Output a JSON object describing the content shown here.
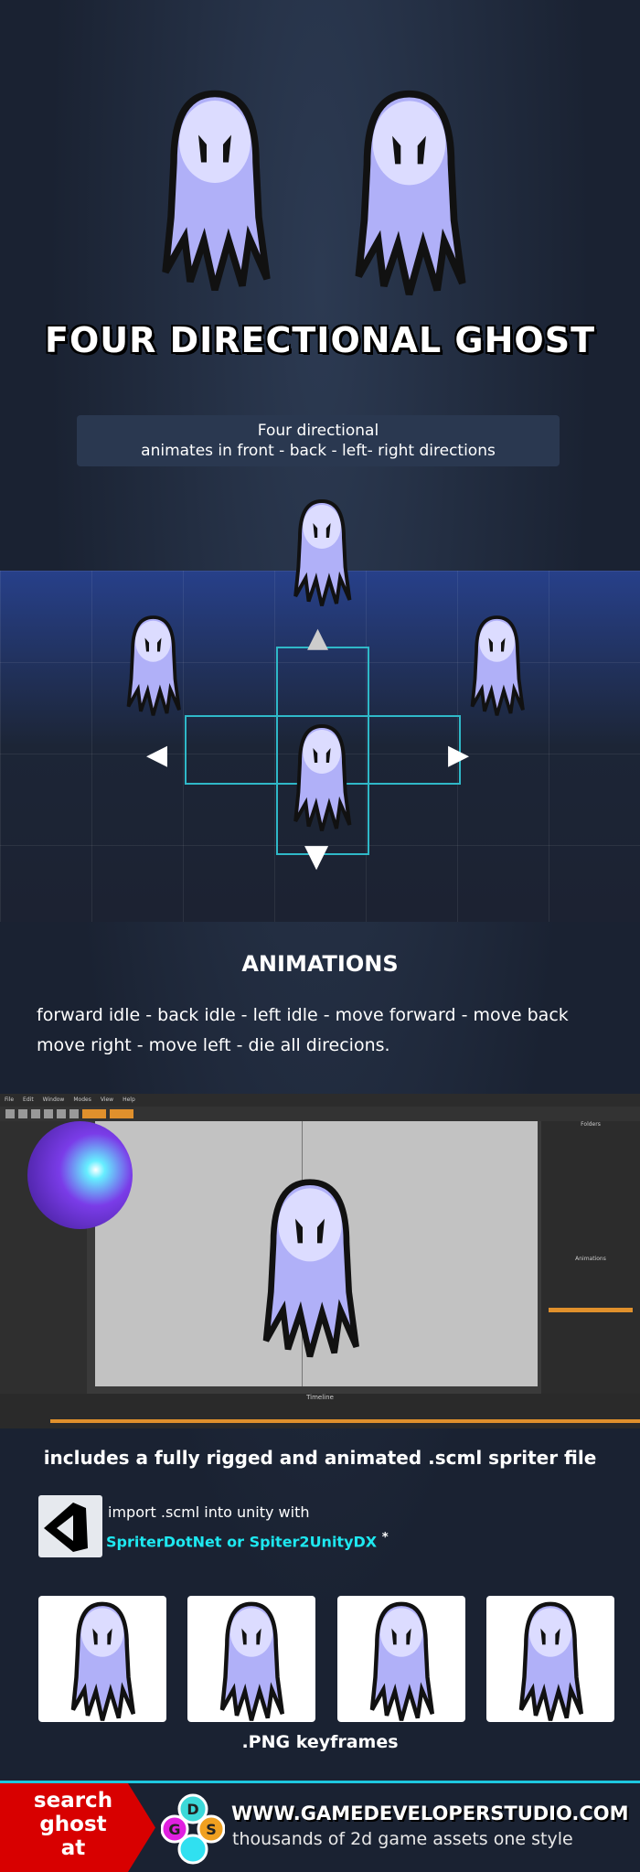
{
  "header": {
    "title": "FOUR DIRECTIONAL  GHOST"
  },
  "info": {
    "line1": "Four directional",
    "line2": "animates in front - back - left- right directions"
  },
  "animations": {
    "heading": "ANIMATIONS",
    "line1": "forward idle - back idle - left idle - move forward - move back",
    "line2": "move right - move left - die all direcions."
  },
  "editor": {
    "menu": [
      "File",
      "Edit",
      "Window",
      "Modes",
      "View",
      "Help"
    ],
    "timeline_label": "Timeline",
    "panels": {
      "folders": "Folders",
      "animations": "Animations"
    }
  },
  "spriter": {
    "includes": "includes a fully rigged and animated .scml spriter file",
    "import": "import .scml into unity with",
    "plugins": "SpriterDotNet or Spiter2UnityDX",
    "asterisk": "*"
  },
  "keyframes": {
    "label": ".PNG keyframes",
    "count": 4
  },
  "footer": {
    "search": "search",
    "ghost": "ghost",
    "at": "at",
    "url": "WWW.GAMEDEVELOPERSTUDIO.COM",
    "tagline": "thousands of 2d game assets one style",
    "logo_letters": [
      "D",
      "G",
      "S"
    ]
  },
  "colors": {
    "accent": "#1ee8f0",
    "red": "#d80000",
    "ghost": "#b8b8ff",
    "orange": "#e0902c"
  }
}
